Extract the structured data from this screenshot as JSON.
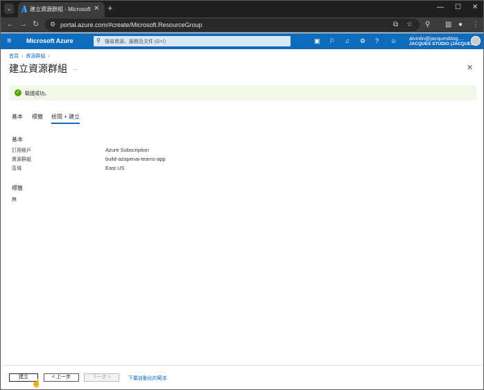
{
  "browser": {
    "tab_title": "建立資源群組 - Microsoft Azure",
    "url": "portal.azure.com/#create/Microsoft.ResourceGroup"
  },
  "azure": {
    "brand": "Microsoft Azure",
    "search_placeholder": "搜尋資源、服務及文件 (G+/)",
    "user_email": "alvinlin@jacquesblog....",
    "user_directory": "JACQUES STUDIO (JACQUES..."
  },
  "breadcrumb": [
    "首頁",
    "資源群組"
  ],
  "page": {
    "title": "建立資源群組",
    "more": "...",
    "banner": "驗證成功。"
  },
  "tabs": [
    "基本",
    "標籤",
    "檢閱 + 建立"
  ],
  "review": {
    "basics_heading": "基本",
    "fields": [
      {
        "label": "訂用帳戶",
        "value": "Azure Subscription"
      },
      {
        "label": "資源群組",
        "value": "build-azopenai-teams-app"
      },
      {
        "label": "區域",
        "value": "East US"
      }
    ],
    "tags_heading": "標籤",
    "tags_value": "無"
  },
  "footer": {
    "create": "建立",
    "previous": "< 上一步",
    "next": "下一步 >",
    "automation": "下載自動化的範本"
  },
  "colors": {
    "azure_blue": "#0f6cbd",
    "success": "#57a300",
    "banner_bg": "#f1f7e9"
  }
}
